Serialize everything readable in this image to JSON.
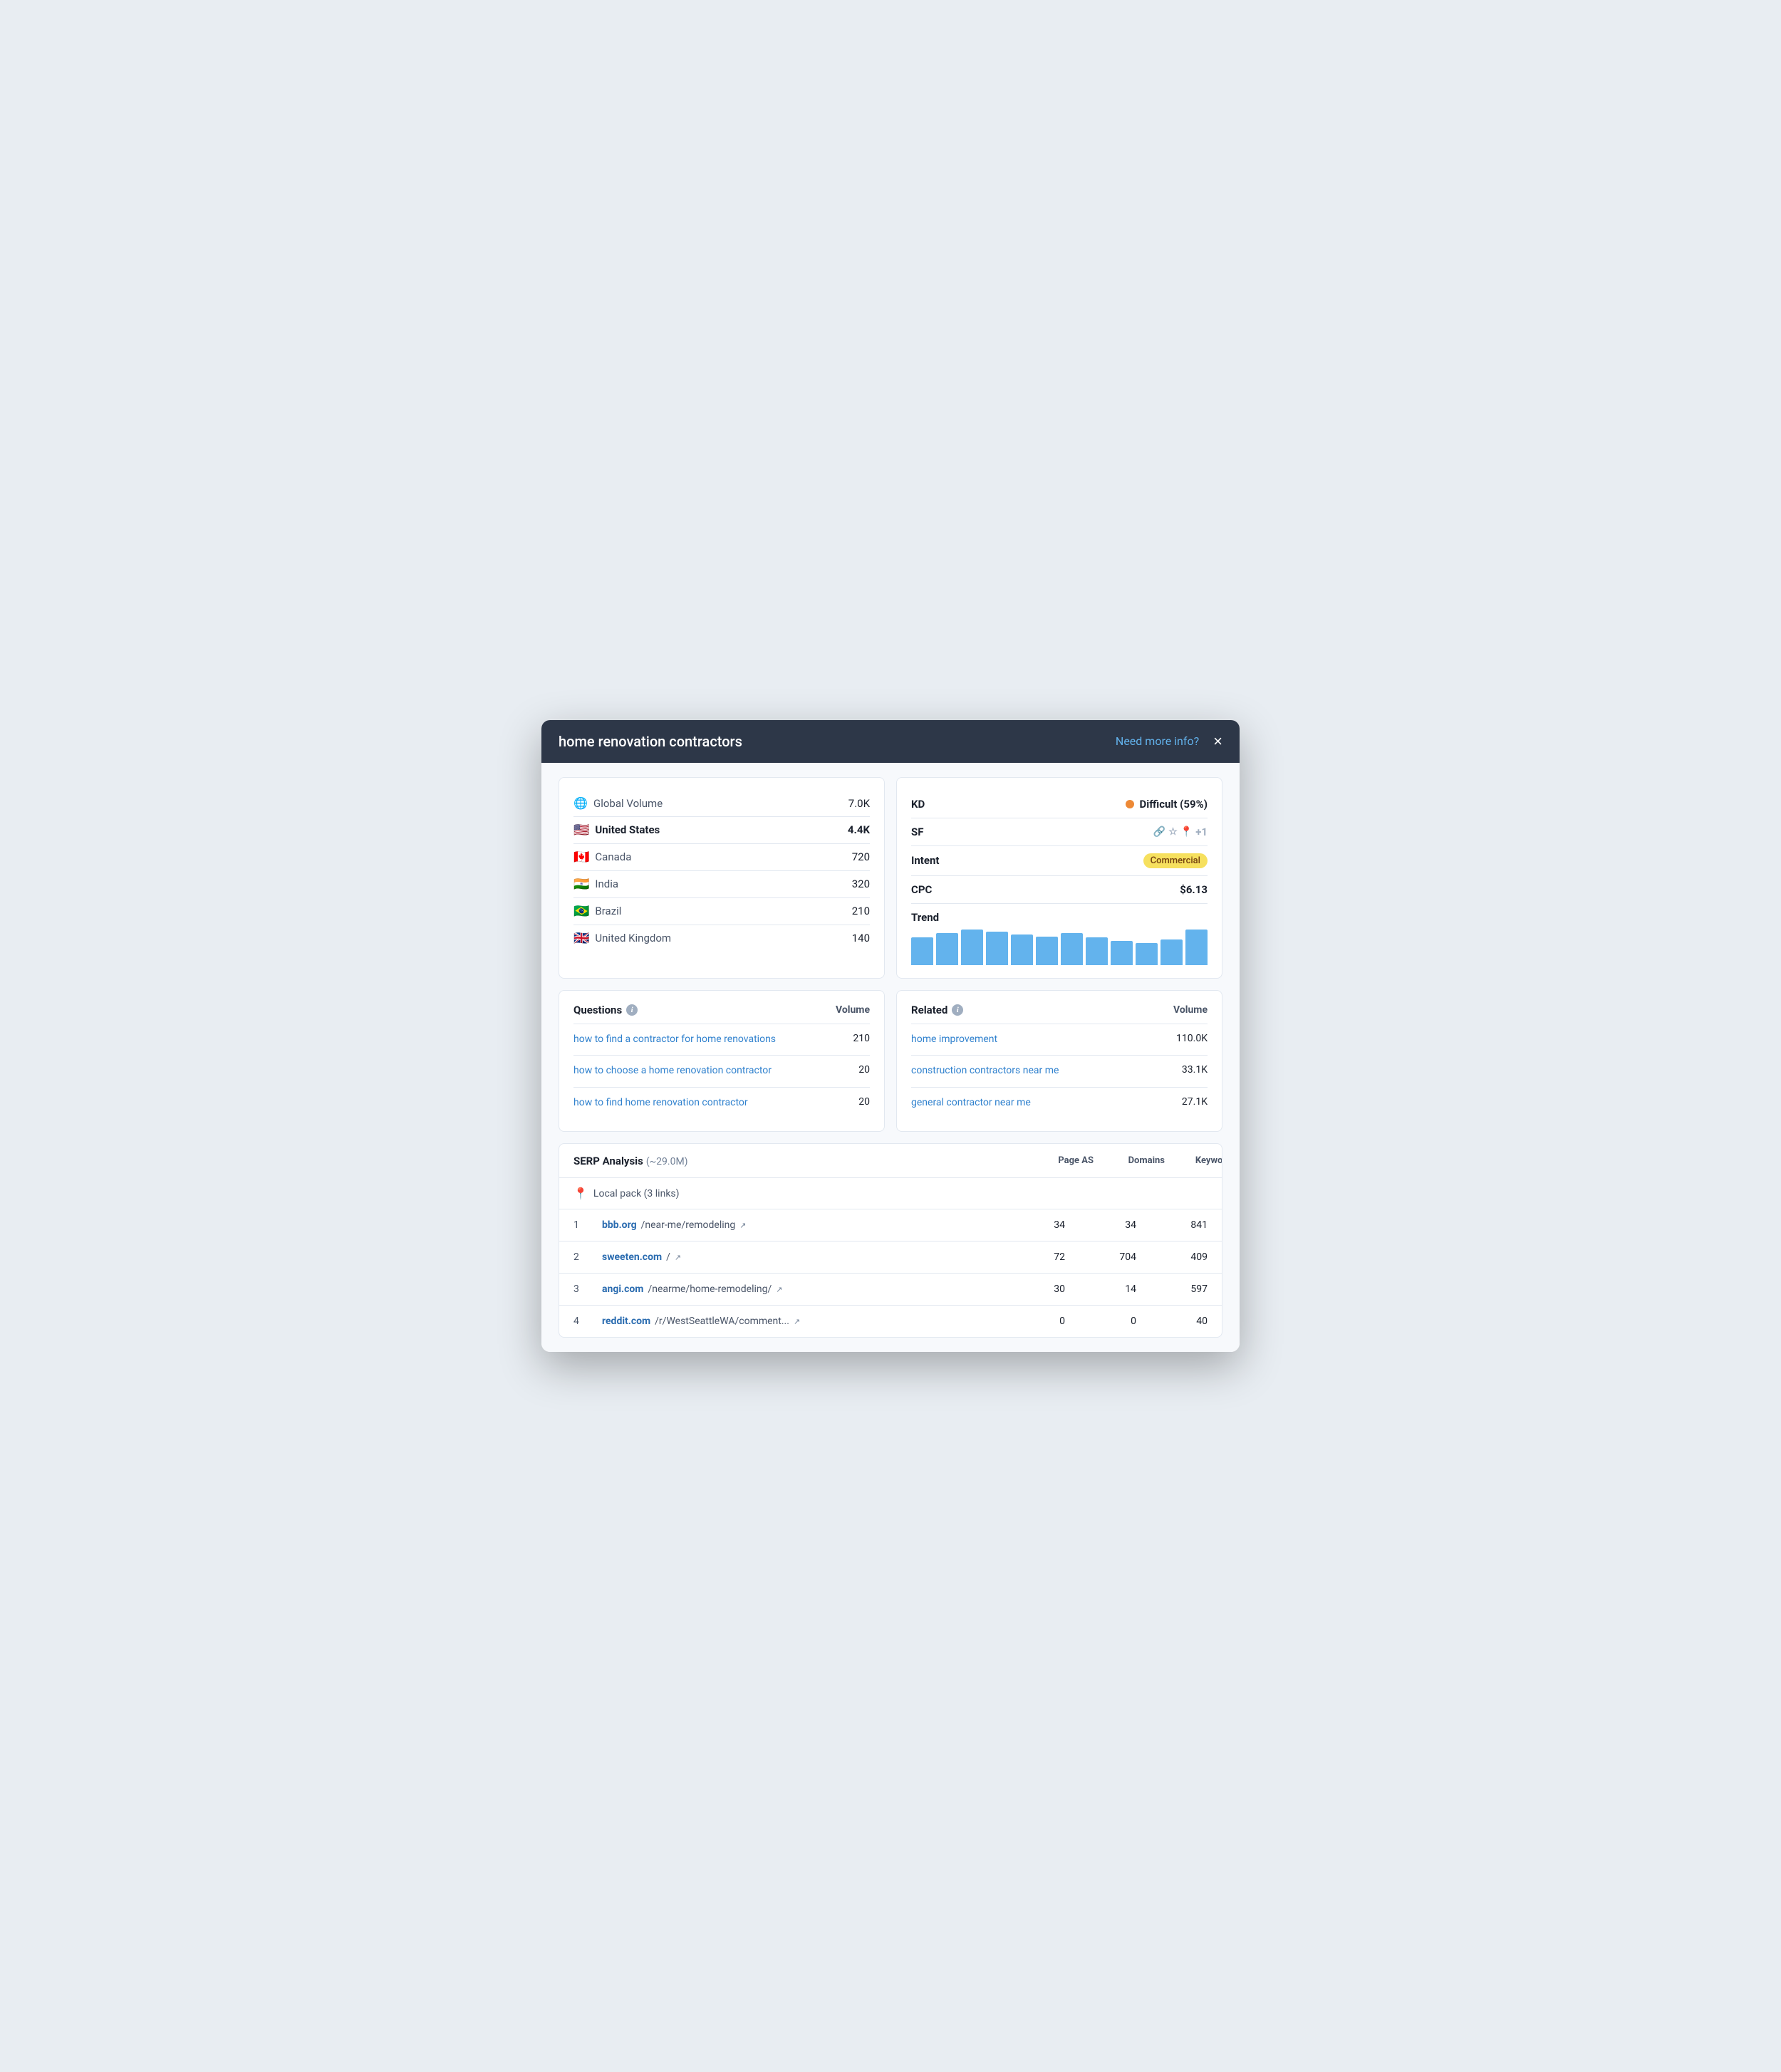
{
  "modal": {
    "title": "home renovation contractors",
    "need_more_info": "Need more info?",
    "close": "×"
  },
  "volume_card": {
    "global_label": "Global Volume",
    "global_value": "7.0K",
    "countries": [
      {
        "flag": "🇺🇸",
        "name": "United States",
        "value": "4.4K",
        "bold": true
      },
      {
        "flag": "🇨🇦",
        "name": "Canada",
        "value": "720",
        "bold": false
      },
      {
        "flag": "🇮🇳",
        "name": "India",
        "value": "320",
        "bold": false
      },
      {
        "flag": "🇧🇷",
        "name": "Brazil",
        "value": "210",
        "bold": false
      },
      {
        "flag": "🇬🇧",
        "name": "United Kingdom",
        "value": "140",
        "bold": false
      }
    ]
  },
  "kd_card": {
    "kd_label": "KD",
    "kd_value": "Difficult (59%)",
    "sf_label": "SF",
    "sf_extra": "+1",
    "intent_label": "Intent",
    "intent_value": "Commercial",
    "cpc_label": "CPC",
    "cpc_value": "$6.13",
    "trend_label": "Trend",
    "trend_bars": [
      35,
      40,
      45,
      42,
      38,
      36,
      40,
      35,
      30,
      28,
      32,
      45
    ]
  },
  "questions": {
    "title": "Questions",
    "volume_header": "Volume",
    "items": [
      {
        "text": "how to find a contractor for home renovations",
        "volume": "210"
      },
      {
        "text": "how to choose a home renovation contractor",
        "volume": "20"
      },
      {
        "text": "how to find home renovation contractor",
        "volume": "20"
      }
    ]
  },
  "related": {
    "title": "Related",
    "volume_header": "Volume",
    "items": [
      {
        "text": "home improvement",
        "volume": "110.0K"
      },
      {
        "text": "construction contractors near me",
        "volume": "33.1K"
      },
      {
        "text": "general contractor near me",
        "volume": "27.1K"
      }
    ]
  },
  "serp": {
    "title": "SERP Analysis",
    "count": "(~29.0M)",
    "col_page_as": "Page AS",
    "col_domains": "Domains",
    "col_keywords": "Keywords",
    "local_pack": "Local pack (3 links)",
    "rows": [
      {
        "num": "1",
        "domain": "bbb.org",
        "path": "/near-me/remodeling",
        "page_as": "34",
        "domains": "34",
        "keywords": "841"
      },
      {
        "num": "2",
        "domain": "sweeten.com",
        "path": "/",
        "page_as": "72",
        "domains": "704",
        "keywords": "409"
      },
      {
        "num": "3",
        "domain": "angi.com",
        "path": "/nearme/home-remodeling/",
        "page_as": "30",
        "domains": "14",
        "keywords": "597"
      },
      {
        "num": "4",
        "domain": "reddit.com",
        "path": "/r/WestSeattleWA/comment...",
        "page_as": "0",
        "domains": "0",
        "keywords": "40"
      }
    ]
  }
}
